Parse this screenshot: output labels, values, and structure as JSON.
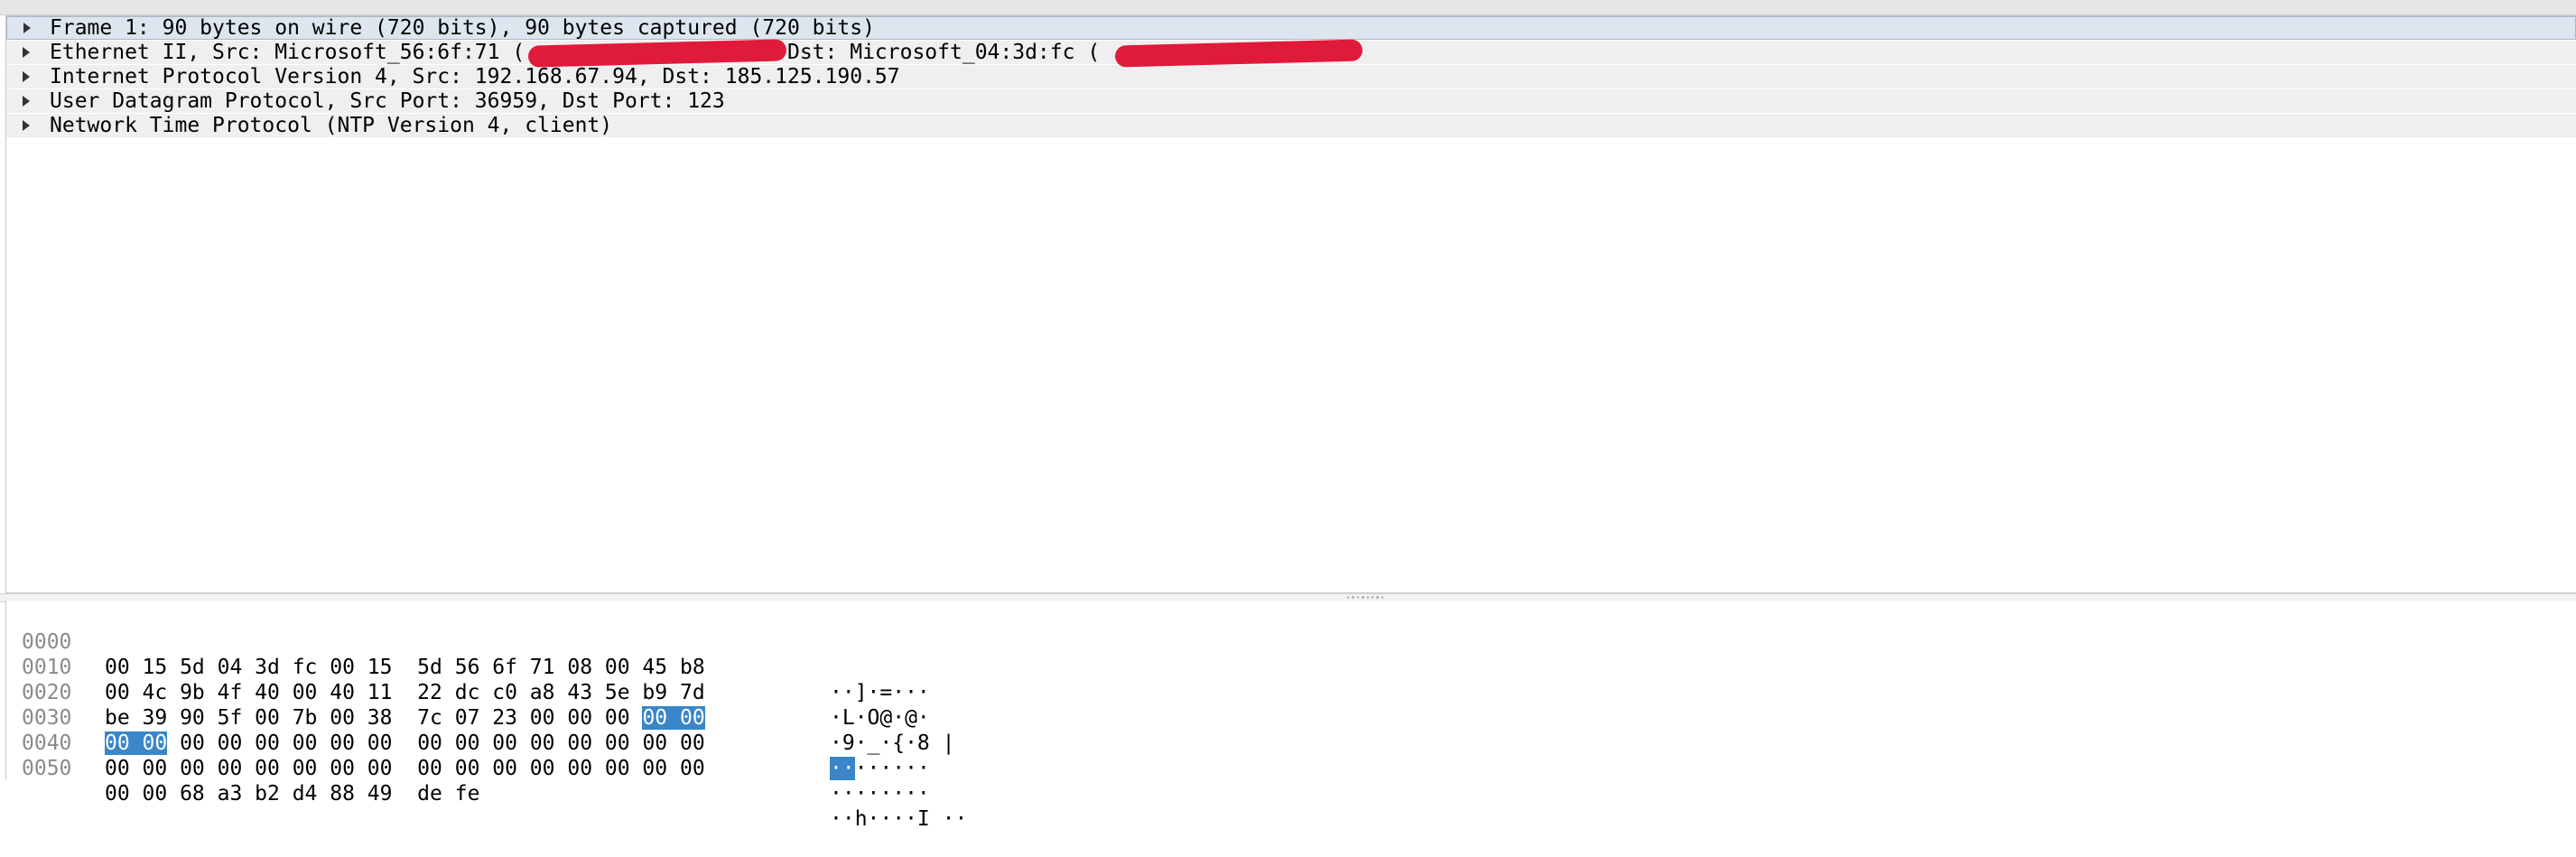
{
  "details": {
    "rows": [
      {
        "label": "Frame 1: 90 bytes on wire (720 bits), 90 bytes captured (720 bits)",
        "selected": true
      },
      {
        "label": "Ethernet II, Src: Microsoft_56:6f:71 (                  ), Dst: Microsoft_04:3d:fc (                 )",
        "selected": false
      },
      {
        "label": "Internet Protocol Version 4, Src: 192.168.67.94, Dst: 185.125.190.57",
        "selected": false
      },
      {
        "label": "User Datagram Protocol, Src Port: 36959, Dst Port: 123",
        "selected": false
      },
      {
        "label": "Network Time Protocol (NTP Version 4, client)",
        "selected": false
      }
    ],
    "redaction_color": "#e01a3a"
  },
  "bytes": {
    "rows": [
      {
        "offset": "0000",
        "hex_a": "00 15 5d 04 3d fc 00 15  5d 56 6f 71 08 00 45 b8",
        "hex_hl": "",
        "hex_b": "",
        "ascii_a": "··]·=···",
        "ascii_hl": "",
        "ascii_b": ""
      },
      {
        "offset": "0010",
        "hex_a": "00 4c 9b 4f 40 00 40 11  22 dc c0 a8 43 5e b9 7d",
        "hex_hl": "",
        "hex_b": "",
        "ascii_a": "·L·O@·@·",
        "ascii_hl": "",
        "ascii_b": ""
      },
      {
        "offset": "0020",
        "hex_a": "be 39 90 5f 00 7b 00 38  7c 07 23 00 00 00 ",
        "hex_hl": "00 00",
        "hex_b": "",
        "ascii_a": "·9·_·{·8 |",
        "ascii_hl": "",
        "ascii_b": ""
      },
      {
        "offset": "0030",
        "hex_a": "",
        "hex_hl": "00 00",
        "hex_b": " 00 00 00 00 00 00  00 00 00 00 00 00 00 00",
        "ascii_a": "",
        "ascii_hl": "··",
        "ascii_b": "······"
      },
      {
        "offset": "0040",
        "hex_a": "00 00 00 00 00 00 00 00  00 00 00 00 00 00 00 00",
        "hex_hl": "",
        "hex_b": "",
        "ascii_a": "········",
        "ascii_hl": "",
        "ascii_b": ""
      },
      {
        "offset": "0050",
        "hex_a": "00 00 68 a3 b2 d4 88 49  de fe",
        "hex_hl": "",
        "hex_b": "",
        "ascii_a": "··h····I ··",
        "ascii_hl": "",
        "ascii_b": ""
      }
    ],
    "highlight_color": "#3a86c8"
  }
}
